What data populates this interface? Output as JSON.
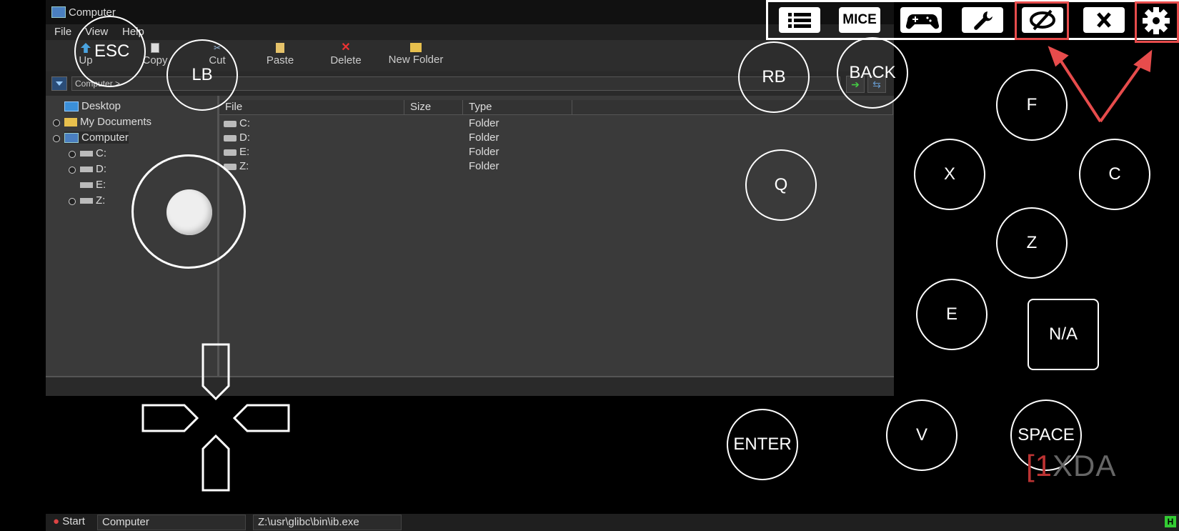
{
  "window": {
    "title": "Computer"
  },
  "menu": {
    "file": "File",
    "view": "View",
    "help": "Help"
  },
  "toolbar": {
    "up": "Up",
    "copy": "Copy",
    "cut": "Cut",
    "paste": "Paste",
    "delete": "Delete",
    "new_folder": "New Folder"
  },
  "address": {
    "path": "Computer >"
  },
  "tree": {
    "desktop": "Desktop",
    "my_documents": "My Documents",
    "computer": "Computer",
    "c": "C:",
    "d": "D:",
    "e": "E:",
    "z": "Z:"
  },
  "files": {
    "headers": {
      "file": "File",
      "size": "Size",
      "type": "Type"
    },
    "rows": [
      {
        "name": "C:",
        "type": "Folder"
      },
      {
        "name": "D:",
        "type": "Folder"
      },
      {
        "name": "E:",
        "type": "Folder"
      },
      {
        "name": "Z:",
        "type": "Folder"
      }
    ]
  },
  "taskbar": {
    "start": "Start",
    "computer": "Computer",
    "path": "Z:\\usr\\glibc\\bin\\ib.exe",
    "tray": "H"
  },
  "overlay": {
    "esc": "ESC",
    "lb": "LB",
    "rb": "RB",
    "back": "BACK",
    "f": "F",
    "x": "X",
    "c": "C",
    "q": "Q",
    "z": "Z",
    "e": "E",
    "na": "N/A",
    "enter": "ENTER",
    "v": "V",
    "space": "SPACE",
    "mice": "MICE",
    "watermark": "XDA"
  },
  "colors": {
    "highlight": "#e74c4c",
    "overlay": "#ffffff"
  }
}
